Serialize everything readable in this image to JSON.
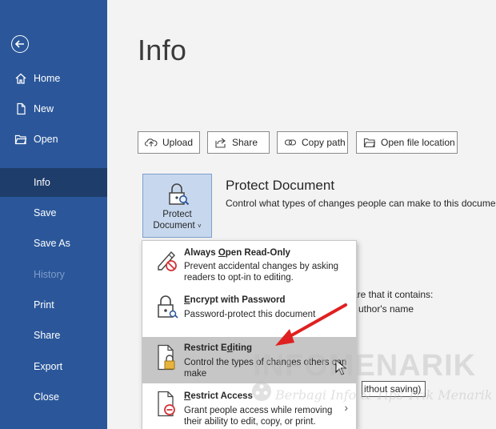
{
  "sidebar": {
    "back_icon": "back-arrow-icon",
    "items": [
      {
        "label": "Home",
        "icon": "home-icon"
      },
      {
        "label": "New",
        "icon": "new-document-icon"
      },
      {
        "label": "Open",
        "icon": "folder-icon"
      },
      {
        "label": "Info",
        "active": true
      },
      {
        "label": "Save"
      },
      {
        "label": "Save As"
      },
      {
        "label": "History",
        "disabled": true
      },
      {
        "label": "Print"
      },
      {
        "label": "Share"
      },
      {
        "label": "Export"
      },
      {
        "label": "Close"
      }
    ],
    "colors": {
      "background": "#2b579a",
      "active": "#1f3d6b"
    }
  },
  "main": {
    "title": "Info",
    "toolbar": [
      {
        "label": "Upload",
        "icon": "upload-cloud-icon"
      },
      {
        "label": "Share",
        "icon": "share-icon"
      },
      {
        "label": "Copy path",
        "icon": "link-icon"
      },
      {
        "label": "Open file location",
        "icon": "folder-icon"
      }
    ],
    "protect": {
      "button_line1": "Protect",
      "button_line2": "Document",
      "title": "Protect Document",
      "description": "Control what types of changes people can make to this document."
    },
    "background_text": {
      "inspect_line": "are that it contains:",
      "author_line": "uthor's name",
      "box_text": "ithout saving)"
    }
  },
  "menu": {
    "items": [
      {
        "title_pre": "Always ",
        "title_u": "O",
        "title_post": "pen Read-Only",
        "description": "Prevent accidental changes by asking readers to opt-in to editing.",
        "icon": "pencil-no-icon"
      },
      {
        "title_pre": "",
        "title_u": "E",
        "title_post": "ncrypt with Password",
        "description": "Password-protect this document",
        "icon": "lock-key-icon"
      },
      {
        "title_pre": "Restrict E",
        "title_u": "d",
        "title_post": "iting",
        "description": "Control the types of changes others can make",
        "icon": "document-lock-icon",
        "hover": true
      },
      {
        "title_pre": "",
        "title_u": "R",
        "title_post": "estrict Access",
        "description": "Grant people access while removing their ability to edit, copy, or print.",
        "icon": "document-restricted-icon",
        "has_submenu": true
      }
    ]
  },
  "watermark": {
    "main": "INFOMENARIK",
    "sub": "Berbagi Info & Tips Trik Menarik"
  }
}
